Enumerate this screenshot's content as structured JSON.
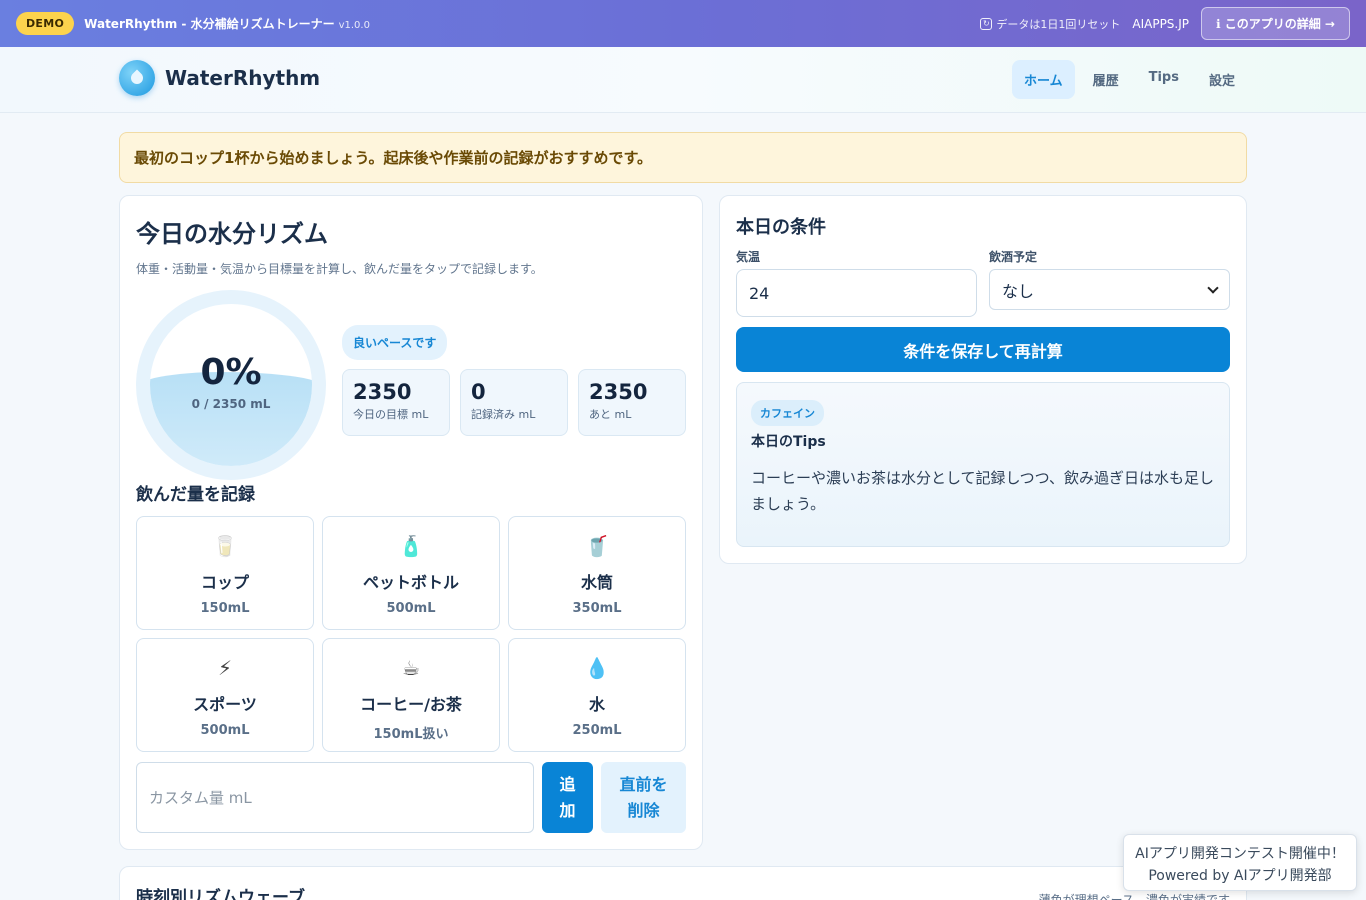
{
  "demo_bar": {
    "badge": "DEMO",
    "title": "WaterRhythm - 水分補給リズムトレーナー",
    "version": "v1.0.0",
    "reset_note": "データは1日1回リセット",
    "site": "AIAPPS.JP",
    "detail_button": "ℹ このアプリの詳細 →"
  },
  "header": {
    "brand": "WaterRhythm",
    "nav": [
      "ホーム",
      "履歴",
      "Tips",
      "設定"
    ],
    "active_nav": "ホーム"
  },
  "notice": "最初のコップ1杯から始めましょう。起床後や作業前の記録がおすすめです。",
  "main": {
    "title": "今日の水分リズム",
    "subtitle": "体重・活動量・気温から目標量を計算し、飲んだ量をタップで記録します。",
    "progress_percent": "0%",
    "progress_amount": "0 / 2350 mL",
    "progress_fraction": 0,
    "pace": "良いペースです",
    "stats": [
      {
        "value": "2350",
        "label": "今日の目標 mL"
      },
      {
        "value": "0",
        "label": "記録済み mL"
      },
      {
        "value": "2350",
        "label": "あと mL"
      }
    ],
    "record_title": "飲んだ量を記録",
    "drinks": [
      {
        "icon": "🥛",
        "icon_name": "glass-of-milk-icon",
        "name": "コップ",
        "amount": "150mL"
      },
      {
        "icon": "🧴",
        "icon_name": "bottle-icon",
        "name": "ペットボトル",
        "amount": "500mL"
      },
      {
        "icon": "🥤",
        "icon_name": "tumbler-icon",
        "name": "水筒",
        "amount": "350mL"
      },
      {
        "icon": "⚡",
        "icon_name": "lightning-icon",
        "name": "スポーツ",
        "amount": "500mL"
      },
      {
        "icon": "☕",
        "icon_name": "coffee-icon",
        "name": "コーヒー/お茶",
        "amount": "150mL扱い"
      },
      {
        "icon": "💧",
        "icon_name": "droplet-icon",
        "name": "水",
        "amount": "250mL"
      }
    ],
    "custom_placeholder": "カスタム量 mL",
    "add_button": "追加",
    "undo_button": "直前を削除"
  },
  "side": {
    "title": "本日の条件",
    "temp_label": "気温",
    "temp_value": "24",
    "alcohol_label": "飲酒予定",
    "alcohol_value": "なし",
    "save_button": "条件を保存して再計算",
    "tip_badge": "カフェイン",
    "tip_title": "本日のTips",
    "tip_body": "コーヒーや濃いお茶は水分として記録しつつ、飲み過ぎ日は水も足しましょう。"
  },
  "bottom": {
    "title": "時刻別リズムウェーブ",
    "note": "薄色が理想ペース、濃色が実績です"
  },
  "contest": {
    "line1": "AIアプリ開発コンテスト開催中！",
    "line2": "Powered by AIアプリ開発部"
  },
  "colors": {
    "accent": "#0984d6",
    "demo_badge": "#fcd34d",
    "notice_bg": "#fef5dc"
  }
}
